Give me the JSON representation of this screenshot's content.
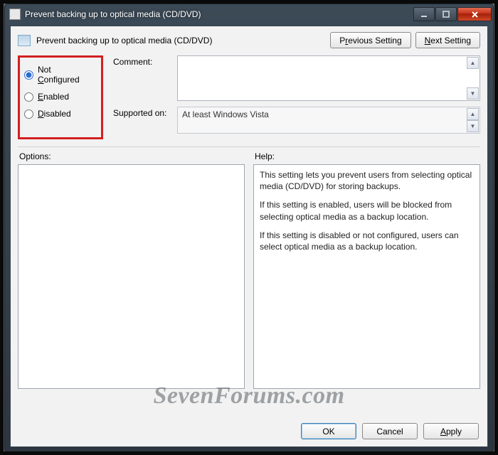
{
  "window": {
    "title": "Prevent backing up to optical media (CD/DVD)"
  },
  "header": {
    "policy_title": "Prevent backing up to optical media (CD/DVD)",
    "previous_label_pre": "P",
    "previous_label_ul": "r",
    "previous_label_post": "evious Setting",
    "next_label_ul": "N",
    "next_label_post": "ext Setting"
  },
  "state_options": {
    "not_configured": {
      "pre": "Not ",
      "ul": "C",
      "post": "onfigured"
    },
    "enabled": {
      "ul": "E",
      "post": "nabled"
    },
    "disabled": {
      "ul": "D",
      "post": "isabled"
    },
    "selected": "not_configured"
  },
  "fields": {
    "comment_label": "Comment:",
    "comment_value": "",
    "supported_label": "Supported on:",
    "supported_value": "At least Windows Vista"
  },
  "columns": {
    "options_label": "Options:",
    "help_label": "Help:"
  },
  "help": {
    "p1": "This setting lets you prevent users from selecting optical media (CD/DVD) for storing backups.",
    "p2": "If this setting is enabled, users will be blocked from selecting optical media as a backup location.",
    "p3": "If this setting is disabled or not configured, users can select optical media as a backup location."
  },
  "buttons": {
    "ok": "OK",
    "cancel": "Cancel",
    "apply_ul": "A",
    "apply_post": "pply"
  },
  "watermark": "SevenForums.com",
  "glyphs": {
    "up": "▲",
    "down": "▼"
  }
}
